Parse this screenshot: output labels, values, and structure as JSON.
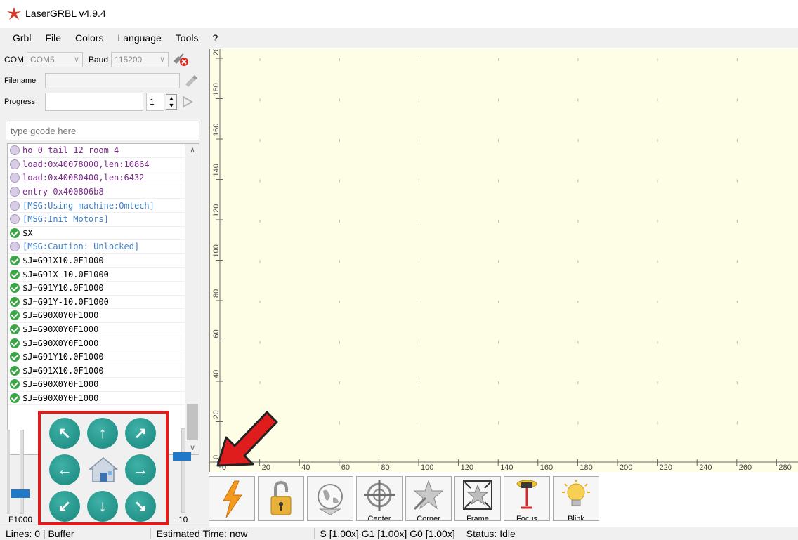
{
  "window": {
    "title": "LaserGRBL v4.9.4"
  },
  "menu": [
    "Grbl",
    "File",
    "Colors",
    "Language",
    "Tools",
    "?"
  ],
  "connection": {
    "com_label": "COM",
    "com_value": "COM5",
    "baud_label": "Baud",
    "baud_value": "115200",
    "filename_label": "Filename",
    "filename_value": "",
    "progress_label": "Progress",
    "progress_value": "",
    "copies_value": "1"
  },
  "gcode_input": {
    "placeholder": "type gcode here"
  },
  "log": [
    {
      "text": "ho 0 tail 12 room 4",
      "kind": "info",
      "color": "purple"
    },
    {
      "text": "load:0x40078000,len:10864",
      "kind": "info",
      "color": "purple"
    },
    {
      "text": "load:0x40080400,len:6432",
      "kind": "info",
      "color": "purple"
    },
    {
      "text": "entry 0x400806b8",
      "kind": "info",
      "color": "purple"
    },
    {
      "text": "[MSG:Using machine:Omtech]",
      "kind": "info",
      "color": "blue"
    },
    {
      "text": "[MSG:Init Motors]",
      "kind": "info",
      "color": "blue"
    },
    {
      "text": "$X",
      "kind": "ok",
      "color": "black"
    },
    {
      "text": "[MSG:Caution: Unlocked]",
      "kind": "info",
      "color": "blue"
    },
    {
      "text": "$J=G91X10.0F1000",
      "kind": "ok",
      "color": "black"
    },
    {
      "text": "$J=G91X-10.0F1000",
      "kind": "ok",
      "color": "black"
    },
    {
      "text": "$J=G91Y10.0F1000",
      "kind": "ok",
      "color": "black"
    },
    {
      "text": "$J=G91Y-10.0F1000",
      "kind": "ok",
      "color": "black"
    },
    {
      "text": "$J=G90X0Y0F1000",
      "kind": "ok",
      "color": "black"
    },
    {
      "text": "$J=G90X0Y0F1000",
      "kind": "ok",
      "color": "black"
    },
    {
      "text": "$J=G90X0Y0F1000",
      "kind": "ok",
      "color": "black"
    },
    {
      "text": "$J=G91Y10.0F1000",
      "kind": "ok",
      "color": "black"
    },
    {
      "text": "$J=G91X10.0F1000",
      "kind": "ok",
      "color": "black"
    },
    {
      "text": "$J=G90X0Y0F1000",
      "kind": "ok",
      "color": "black"
    },
    {
      "text": "$J=G90X0Y0F1000",
      "kind": "ok",
      "color": "black"
    }
  ],
  "jog": {
    "feed_label": "F1000",
    "step_label": "10"
  },
  "canvas": {
    "x_ticks": [
      "0",
      "20",
      "40",
      "60",
      "80",
      "100",
      "120",
      "140",
      "160",
      "180",
      "200",
      "220",
      "240",
      "260",
      "280"
    ],
    "y_ticks": [
      "0",
      "20",
      "40",
      "60",
      "80",
      "100",
      "120",
      "140",
      "160",
      "180",
      "20"
    ]
  },
  "toolbar": [
    {
      "name": "reset",
      "label": ""
    },
    {
      "name": "unlock",
      "label": ""
    },
    {
      "name": "globe",
      "label": ""
    },
    {
      "name": "center",
      "label": "Center"
    },
    {
      "name": "corner",
      "label": "Corner"
    },
    {
      "name": "frame",
      "label": "Frame"
    },
    {
      "name": "focus",
      "label": "Focus"
    },
    {
      "name": "blink",
      "label": "Blink"
    }
  ],
  "status": {
    "lines": "Lines: 0 | Buffer",
    "estimated": "Estimated Time: now",
    "overrides": "S [1.00x] G1 [1.00x] G0 [1.00x]",
    "status": "Status: Idle"
  },
  "colors": {
    "accent_red": "#e01d1d",
    "jog_teal": "#1c8c82",
    "canvas_bg": "#fefde6"
  }
}
